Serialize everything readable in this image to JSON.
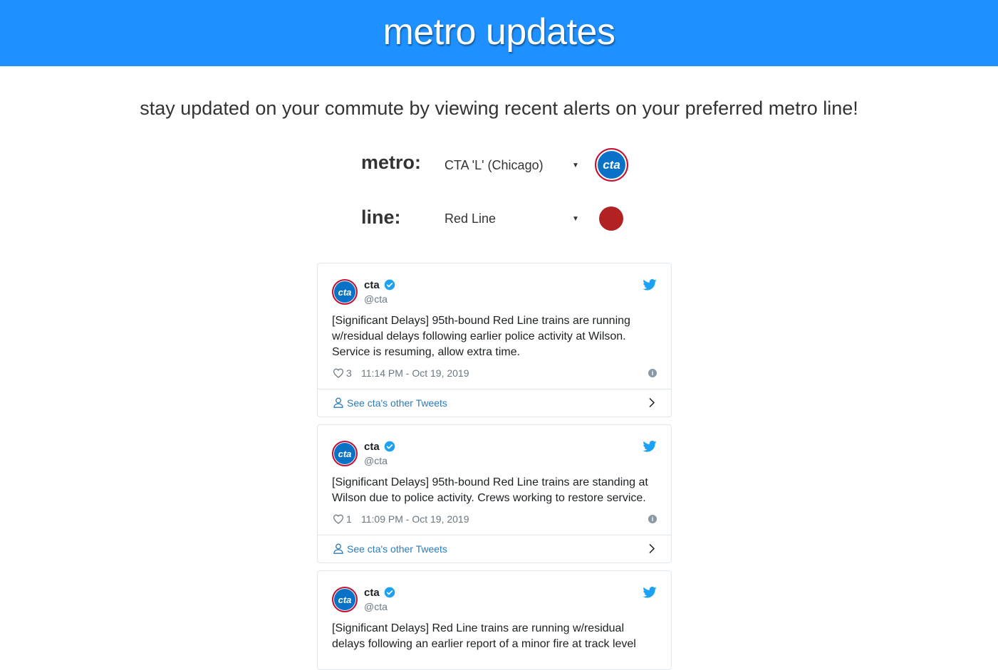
{
  "header": {
    "title": "metro updates"
  },
  "tagline": "stay updated on your commute by viewing recent alerts on your preferred metro line!",
  "metro": {
    "label": "metro:",
    "selected": "CTA 'L' (Chicago)",
    "logo_text": "cta"
  },
  "line": {
    "label": "line:",
    "selected": "Red Line",
    "color": "#b22222"
  },
  "colors": {
    "header_bg": "#1e90ff",
    "cta_blue": "#0a72c6",
    "cta_red": "#c8102e",
    "twitter_blue": "#1da1f2",
    "link_blue": "#2b7bb9"
  },
  "tweets": [
    {
      "name": "cta",
      "handle": "@cta",
      "avatar_text": "cta",
      "text": "[Significant Delays] 95th-bound Red Line trains are running w/residual delays following earlier police activity at Wilson. Service is resuming, allow extra time.",
      "likes": "3",
      "timestamp": "11:14 PM - Oct 19, 2019",
      "footer_link": "See cta's other Tweets"
    },
    {
      "name": "cta",
      "handle": "@cta",
      "avatar_text": "cta",
      "text": "[Significant Delays] 95th-bound Red Line trains are standing at Wilson due to police activity. Crews working to restore service.",
      "likes": "1",
      "timestamp": "11:09 PM - Oct 19, 2019",
      "footer_link": "See cta's other Tweets"
    },
    {
      "name": "cta",
      "handle": "@cta",
      "avatar_text": "cta",
      "text": "[Significant Delays] Red Line trains are running w/residual delays following an earlier report of a minor fire at track level"
    }
  ],
  "icons": [
    "verified-icon",
    "twitter-bird-icon",
    "heart-icon",
    "info-icon",
    "person-icon",
    "chevron-right-icon"
  ]
}
